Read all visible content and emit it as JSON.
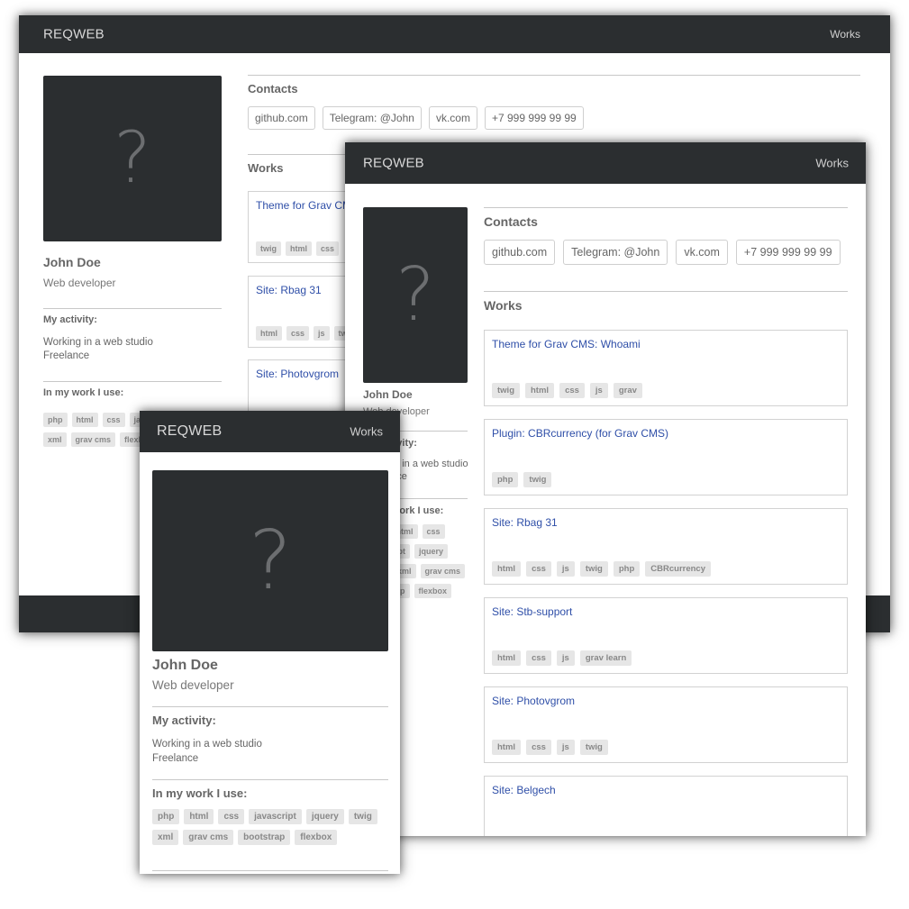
{
  "brand": "REQWEB",
  "nav_works": "Works",
  "profile": {
    "name": "John Doe",
    "role": "Web developer",
    "activity_heading": "My activity:",
    "activity_lines": [
      "Working in a web studio",
      "Freelance"
    ],
    "uses_heading": "In my work I use:",
    "avatar_placeholder": "?"
  },
  "skills": [
    "php",
    "html",
    "css",
    "javascript",
    "jquery",
    "twig",
    "xml",
    "grav cms",
    "bootstrap",
    "flexbox"
  ],
  "skills_wide_abbrev": [
    "php",
    "html",
    "css",
    "ja",
    "twig",
    "xml",
    "grav cms",
    "flexbox"
  ],
  "skills_mid_visible": [
    "html",
    "css",
    "jquery",
    "grav cms",
    "flexbox"
  ],
  "contacts_heading": "Contacts",
  "contacts": [
    "github.com",
    "Telegram: @John",
    "vk.com",
    "+7 999 999 99 99"
  ],
  "works_heading": "Works",
  "works": [
    {
      "title": "Theme for Grav CMS: Whoami",
      "tags": [
        "twig",
        "html",
        "css",
        "js",
        "grav"
      ]
    },
    {
      "title": "Plugin: CBRcurrency (for Grav CMS)",
      "tags": [
        "php",
        "twig"
      ]
    },
    {
      "title": "Site: Rbag 31",
      "tags": [
        "html",
        "css",
        "js",
        "twig",
        "php",
        "CBRcurrency"
      ]
    },
    {
      "title": "Site: Stb-support",
      "tags": [
        "html",
        "css",
        "js",
        "grav learn"
      ]
    },
    {
      "title": "Site: Photovgrom",
      "tags": [
        "html",
        "css",
        "js",
        "twig"
      ]
    },
    {
      "title": "Site: Belgech",
      "tags": []
    }
  ],
  "wide_works": [
    {
      "title": "Theme for Grav CM",
      "tags": [
        "twig",
        "html",
        "css"
      ]
    },
    {
      "title": "Site: Rbag 31",
      "tags": [
        "html",
        "css",
        "js",
        "tw"
      ]
    },
    {
      "title": "Site: Photovgrom",
      "tags": []
    }
  ],
  "mid_partial": {
    "role_fragment": "eloper",
    "activity_heading_fragment": "ity:",
    "activity_line1_fragment": "in a web studio",
    "activity_line2_fragment": "e",
    "uses_heading_fragment": "ork I use:"
  }
}
